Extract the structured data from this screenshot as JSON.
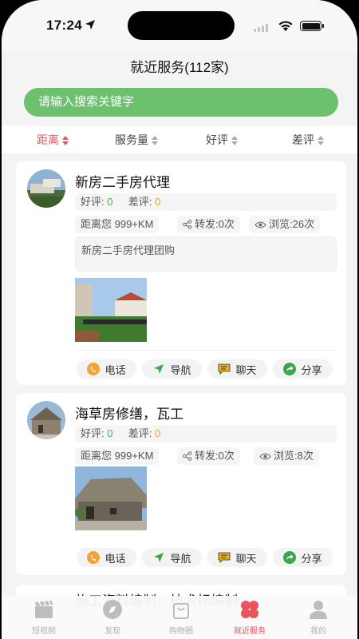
{
  "status_bar": {
    "time": "17:24"
  },
  "header": {
    "title": "就近服务(112家)"
  },
  "search": {
    "placeholder": "请输入搜索关键字"
  },
  "sort_options": [
    {
      "label": "距离",
      "active": true
    },
    {
      "label": "服务量",
      "active": false
    },
    {
      "label": "好评",
      "active": false
    },
    {
      "label": "差评",
      "active": false
    }
  ],
  "listings": [
    {
      "title": "新房二手房代理",
      "good_label": "好评:",
      "good_count": "0",
      "bad_label": "差评:",
      "bad_count": "0",
      "distance": "距离您 999+KM",
      "shares": "转发:0次",
      "views": "浏览:26次",
      "description": "新房二手房代理团购"
    },
    {
      "title": "海草房修缮，瓦工",
      "good_label": "好评:",
      "good_count": "0",
      "bad_label": "差评:",
      "bad_count": "0",
      "distance": "距离您 999+KM",
      "shares": "转发:0次",
      "views": "浏览:8次"
    },
    {
      "title": "施工资料编制，技术标编制"
    }
  ],
  "actions": {
    "call": "电话",
    "navigate": "导航",
    "chat": "聊天",
    "share": "分享"
  },
  "tabbar": [
    {
      "label": "短视频",
      "icon": "clapperboard-icon",
      "active": false
    },
    {
      "label": "发现",
      "icon": "compass-icon",
      "active": false
    },
    {
      "label": "购物圈",
      "icon": "shopping-bag-icon",
      "active": false
    },
    {
      "label": "就近服务",
      "icon": "clover-icon",
      "active": true
    },
    {
      "label": "我的",
      "icon": "person-icon",
      "active": false
    }
  ],
  "colors": {
    "accent_green": "#6cc06e",
    "active_red": "#e8555c",
    "good_green": "#4caf50",
    "bad_orange": "#f0a020"
  }
}
